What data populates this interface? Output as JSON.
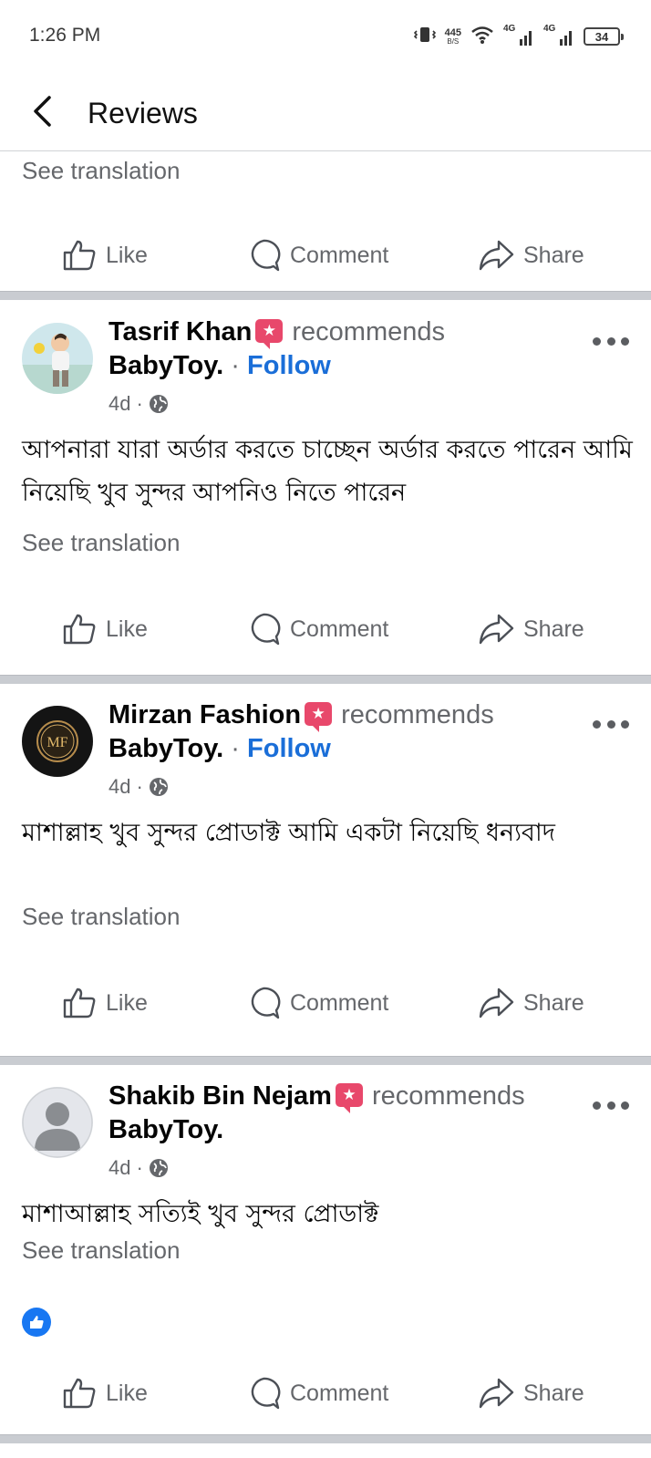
{
  "status_bar": {
    "time": "1:26 PM",
    "speed_value": "445",
    "speed_unit": "B/S",
    "network_1": "4G",
    "network_2": "4G",
    "battery": "34"
  },
  "header": {
    "title": "Reviews"
  },
  "common": {
    "see_translation": "See translation",
    "like_label": "Like",
    "comment_label": "Comment",
    "share_label": "Share",
    "recommends": "recommends",
    "follow": "Follow",
    "dot": "·"
  },
  "posts": [
    {
      "author": "Tasrif Khan",
      "page": "BabyToy.",
      "time": "4d",
      "text": "আপনারা যারা অর্ডার করতে চাচ্ছেন অর্ডার করতে পারেন আমি নিয়েছি খুব সুন্দর আপনিও নিতে পারেন"
    },
    {
      "author": "Mirzan Fashion",
      "page": "BabyToy.",
      "time": "4d",
      "avatar_text": "MF",
      "text": "মাশাল্লাহ খুব সুন্দর প্রোডাক্ট আমি একটা নিয়েছি ধন্যবাদ"
    },
    {
      "author": "Shakib Bin Nejam",
      "page": "BabyToy.",
      "time": "4d",
      "text": "মাশাআল্লাহ সত্যিই খুব সুন্দর প্রোডাক্ট"
    }
  ],
  "colors": {
    "accent": "#1a6ed8",
    "muted": "#65676b",
    "recommend_badge": "#e8486b",
    "like_reaction": "#1877f2"
  }
}
